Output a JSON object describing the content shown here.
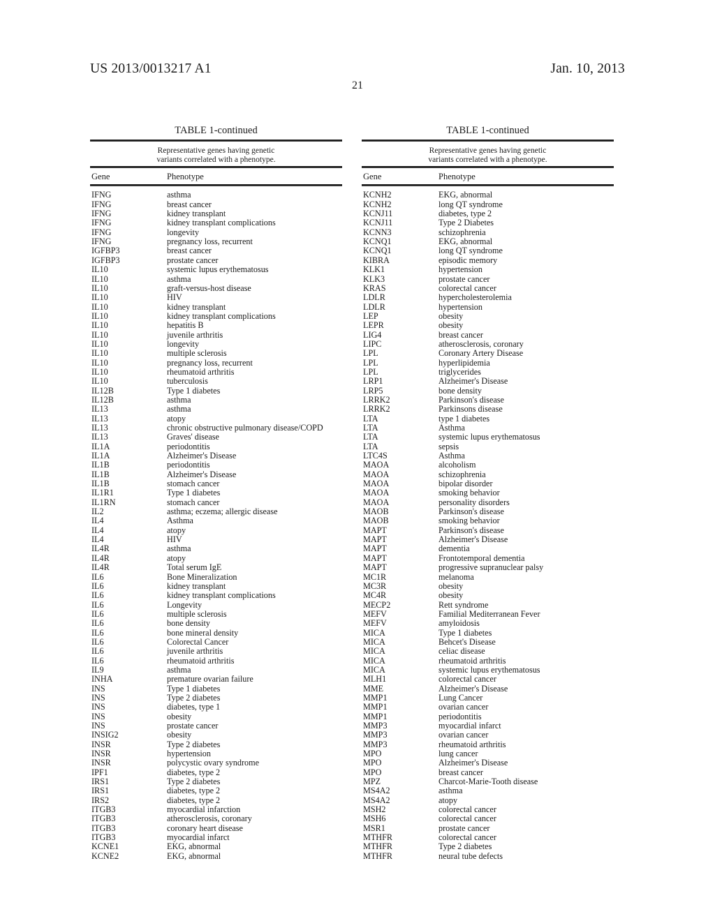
{
  "header": {
    "publication_number": "US 2013/0013217 A1",
    "publication_date": "Jan. 10, 2013",
    "page_number": "21"
  },
  "table": {
    "caption": "TABLE 1-continued",
    "subcaption_line1": "Representative genes having genetic",
    "subcaption_line2": "variants correlated with a phenotype.",
    "column_headers": {
      "gene": "Gene",
      "phenotype": "Phenotype"
    }
  },
  "left_column": {
    "caption": "TABLE 1-continued",
    "subcaption_line1": "Representative genes having genetic",
    "subcaption_line2": "variants correlated with a phenotype.",
    "headers": {
      "gene": "Gene",
      "phenotype": "Phenotype"
    },
    "rows": [
      {
        "gene": "IFNG",
        "phenotype": "asthma"
      },
      {
        "gene": "IFNG",
        "phenotype": "breast cancer"
      },
      {
        "gene": "IFNG",
        "phenotype": "kidney transplant"
      },
      {
        "gene": "IFNG",
        "phenotype": "kidney transplant complications"
      },
      {
        "gene": "IFNG",
        "phenotype": "longevity"
      },
      {
        "gene": "IFNG",
        "phenotype": "pregnancy loss, recurrent"
      },
      {
        "gene": "IGFBP3",
        "phenotype": "breast cancer"
      },
      {
        "gene": "IGFBP3",
        "phenotype": "prostate cancer"
      },
      {
        "gene": "IL10",
        "phenotype": "systemic lupus erythematosus"
      },
      {
        "gene": "IL10",
        "phenotype": "asthma"
      },
      {
        "gene": "IL10",
        "phenotype": "graft-versus-host disease"
      },
      {
        "gene": "IL10",
        "phenotype": "HIV"
      },
      {
        "gene": "IL10",
        "phenotype": "kidney transplant"
      },
      {
        "gene": "IL10",
        "phenotype": "kidney transplant complications"
      },
      {
        "gene": "IL10",
        "phenotype": "hepatitis B"
      },
      {
        "gene": "IL10",
        "phenotype": "juvenile arthritis"
      },
      {
        "gene": "IL10",
        "phenotype": "longevity"
      },
      {
        "gene": "IL10",
        "phenotype": "multiple sclerosis"
      },
      {
        "gene": "IL10",
        "phenotype": "pregnancy loss, recurrent"
      },
      {
        "gene": "IL10",
        "phenotype": "rheumatoid arthritis"
      },
      {
        "gene": "IL10",
        "phenotype": "tuberculosis"
      },
      {
        "gene": "IL12B",
        "phenotype": "Type 1 diabetes"
      },
      {
        "gene": "IL12B",
        "phenotype": "asthma"
      },
      {
        "gene": "IL13",
        "phenotype": "asthma"
      },
      {
        "gene": "IL13",
        "phenotype": "atopy"
      },
      {
        "gene": "IL13",
        "phenotype": "chronic obstructive pulmonary disease/COPD"
      },
      {
        "gene": "IL13",
        "phenotype": "Graves' disease"
      },
      {
        "gene": "IL1A",
        "phenotype": "periodontitis"
      },
      {
        "gene": "IL1A",
        "phenotype": "Alzheimer's Disease"
      },
      {
        "gene": "IL1B",
        "phenotype": "periodontitis"
      },
      {
        "gene": "IL1B",
        "phenotype": "Alzheimer's Disease"
      },
      {
        "gene": "IL1B",
        "phenotype": "stomach cancer"
      },
      {
        "gene": "IL1R1",
        "phenotype": "Type 1 diabetes"
      },
      {
        "gene": "IL1RN",
        "phenotype": "stomach cancer"
      },
      {
        "gene": "IL2",
        "phenotype": "asthma; eczema; allergic disease"
      },
      {
        "gene": "IL4",
        "phenotype": "Asthma"
      },
      {
        "gene": "IL4",
        "phenotype": "atopy"
      },
      {
        "gene": "IL4",
        "phenotype": "HIV"
      },
      {
        "gene": "IL4R",
        "phenotype": "asthma"
      },
      {
        "gene": "IL4R",
        "phenotype": "atopy"
      },
      {
        "gene": "IL4R",
        "phenotype": "Total serum IgE"
      },
      {
        "gene": "IL6",
        "phenotype": "Bone Mineralization"
      },
      {
        "gene": "IL6",
        "phenotype": "kidney transplant"
      },
      {
        "gene": "IL6",
        "phenotype": "kidney transplant complications"
      },
      {
        "gene": "IL6",
        "phenotype": "Longevity"
      },
      {
        "gene": "IL6",
        "phenotype": "multiple sclerosis"
      },
      {
        "gene": "IL6",
        "phenotype": "bone density"
      },
      {
        "gene": "IL6",
        "phenotype": "bone mineral density"
      },
      {
        "gene": "IL6",
        "phenotype": "Colorectal Cancer"
      },
      {
        "gene": "IL6",
        "phenotype": "juvenile arthritis"
      },
      {
        "gene": "IL6",
        "phenotype": "rheumatoid arthritis"
      },
      {
        "gene": "IL9",
        "phenotype": "asthma"
      },
      {
        "gene": "INHA",
        "phenotype": "premature ovarian failure"
      },
      {
        "gene": "INS",
        "phenotype": "Type 1 diabetes"
      },
      {
        "gene": "INS",
        "phenotype": "Type 2 diabetes"
      },
      {
        "gene": "INS",
        "phenotype": "diabetes, type 1"
      },
      {
        "gene": "INS",
        "phenotype": "obesity"
      },
      {
        "gene": "INS",
        "phenotype": "prostate cancer"
      },
      {
        "gene": "INSIG2",
        "phenotype": "obesity"
      },
      {
        "gene": "INSR",
        "phenotype": "Type 2 diabetes"
      },
      {
        "gene": "INSR",
        "phenotype": "hypertension"
      },
      {
        "gene": "INSR",
        "phenotype": "polycystic ovary syndrome"
      },
      {
        "gene": "IPF1",
        "phenotype": "diabetes, type 2"
      },
      {
        "gene": "IRS1",
        "phenotype": "Type 2 diabetes"
      },
      {
        "gene": "IRS1",
        "phenotype": "diabetes, type 2"
      },
      {
        "gene": "IRS2",
        "phenotype": "diabetes, type 2"
      },
      {
        "gene": "ITGB3",
        "phenotype": "myocardial infarction"
      },
      {
        "gene": "ITGB3",
        "phenotype": "atherosclerosis, coronary"
      },
      {
        "gene": "ITGB3",
        "phenotype": "coronary heart disease"
      },
      {
        "gene": "ITGB3",
        "phenotype": "myocardial infarct"
      },
      {
        "gene": "KCNE1",
        "phenotype": "EKG, abnormal"
      },
      {
        "gene": "KCNE2",
        "phenotype": "EKG, abnormal"
      }
    ]
  },
  "right_column": {
    "caption": "TABLE 1-continued",
    "subcaption_line1": "Representative genes having genetic",
    "subcaption_line2": "variants correlated with a phenotype.",
    "headers": {
      "gene": "Gene",
      "phenotype": "Phenotype"
    },
    "rows": [
      {
        "gene": "KCNH2",
        "phenotype": "EKG, abnormal"
      },
      {
        "gene": "KCNH2",
        "phenotype": "long QT syndrome"
      },
      {
        "gene": "KCNJ11",
        "phenotype": "diabetes, type 2"
      },
      {
        "gene": "KCNJ11",
        "phenotype": "Type 2 Diabetes"
      },
      {
        "gene": "KCNN3",
        "phenotype": "schizophrenia"
      },
      {
        "gene": "KCNQ1",
        "phenotype": "EKG, abnormal"
      },
      {
        "gene": "KCNQ1",
        "phenotype": "long QT syndrome"
      },
      {
        "gene": "KIBRA",
        "phenotype": "episodic memory"
      },
      {
        "gene": "KLK1",
        "phenotype": "hypertension"
      },
      {
        "gene": "KLK3",
        "phenotype": "prostate cancer"
      },
      {
        "gene": "KRAS",
        "phenotype": "colorectal cancer"
      },
      {
        "gene": "LDLR",
        "phenotype": "hypercholesterolemia"
      },
      {
        "gene": "LDLR",
        "phenotype": "hypertension"
      },
      {
        "gene": "LEP",
        "phenotype": "obesity"
      },
      {
        "gene": "LEPR",
        "phenotype": "obesity"
      },
      {
        "gene": "LIG4",
        "phenotype": "breast cancer"
      },
      {
        "gene": "LIPC",
        "phenotype": "atherosclerosis, coronary"
      },
      {
        "gene": "LPL",
        "phenotype": "Coronary Artery Disease"
      },
      {
        "gene": "LPL",
        "phenotype": "hyperlipidemia"
      },
      {
        "gene": "LPL",
        "phenotype": "triglycerides"
      },
      {
        "gene": "LRP1",
        "phenotype": "Alzheimer's Disease"
      },
      {
        "gene": "LRP5",
        "phenotype": "bone density"
      },
      {
        "gene": "LRRK2",
        "phenotype": "Parkinson's disease"
      },
      {
        "gene": "LRRK2",
        "phenotype": "Parkinsons disease"
      },
      {
        "gene": "LTA",
        "phenotype": "type 1 diabetes"
      },
      {
        "gene": "LTA",
        "phenotype": "Asthma"
      },
      {
        "gene": "LTA",
        "phenotype": "systemic lupus erythematosus"
      },
      {
        "gene": "LTA",
        "phenotype": "sepsis"
      },
      {
        "gene": "LTC4S",
        "phenotype": "Asthma"
      },
      {
        "gene": "MAOA",
        "phenotype": "alcoholism"
      },
      {
        "gene": "MAOA",
        "phenotype": "schizophrenia"
      },
      {
        "gene": "MAOA",
        "phenotype": "bipolar disorder"
      },
      {
        "gene": "MAOA",
        "phenotype": "smoking behavior"
      },
      {
        "gene": "MAOA",
        "phenotype": "personality disorders"
      },
      {
        "gene": "MAOB",
        "phenotype": "Parkinson's disease"
      },
      {
        "gene": "MAOB",
        "phenotype": "smoking behavior"
      },
      {
        "gene": "MAPT",
        "phenotype": "Parkinson's disease"
      },
      {
        "gene": "MAPT",
        "phenotype": "Alzheimer's Disease"
      },
      {
        "gene": "MAPT",
        "phenotype": "dementia"
      },
      {
        "gene": "MAPT",
        "phenotype": "Frontotemporal dementia"
      },
      {
        "gene": "MAPT",
        "phenotype": "progressive supranuclear palsy"
      },
      {
        "gene": "MC1R",
        "phenotype": "melanoma"
      },
      {
        "gene": "MC3R",
        "phenotype": "obesity"
      },
      {
        "gene": "MC4R",
        "phenotype": "obesity"
      },
      {
        "gene": "MECP2",
        "phenotype": "Rett syndrome"
      },
      {
        "gene": "MEFV",
        "phenotype": "Familial Mediterranean Fever"
      },
      {
        "gene": "MEFV",
        "phenotype": "amyloidosis"
      },
      {
        "gene": "MICA",
        "phenotype": "Type 1 diabetes"
      },
      {
        "gene": "MICA",
        "phenotype": "Behcet's Disease"
      },
      {
        "gene": "MICA",
        "phenotype": "celiac disease"
      },
      {
        "gene": "MICA",
        "phenotype": "rheumatoid arthritis"
      },
      {
        "gene": "MICA",
        "phenotype": "systemic lupus erythematosus"
      },
      {
        "gene": "MLH1",
        "phenotype": "colorectal cancer"
      },
      {
        "gene": "MME",
        "phenotype": "Alzheimer's Disease"
      },
      {
        "gene": "MMP1",
        "phenotype": "Lung Cancer"
      },
      {
        "gene": "MMP1",
        "phenotype": "ovarian cancer"
      },
      {
        "gene": "MMP1",
        "phenotype": "periodontitis"
      },
      {
        "gene": "MMP3",
        "phenotype": "myocardial infarct"
      },
      {
        "gene": "MMP3",
        "phenotype": "ovarian cancer"
      },
      {
        "gene": "MMP3",
        "phenotype": "rheumatoid arthritis"
      },
      {
        "gene": "MPO",
        "phenotype": "lung cancer"
      },
      {
        "gene": "MPO",
        "phenotype": "Alzheimer's Disease"
      },
      {
        "gene": "MPO",
        "phenotype": "breast cancer"
      },
      {
        "gene": "MPZ",
        "phenotype": "Charcot-Marie-Tooth disease"
      },
      {
        "gene": "MS4A2",
        "phenotype": "asthma"
      },
      {
        "gene": "MS4A2",
        "phenotype": "atopy"
      },
      {
        "gene": "MSH2",
        "phenotype": "colorectal cancer"
      },
      {
        "gene": "MSH6",
        "phenotype": "colorectal cancer"
      },
      {
        "gene": "MSR1",
        "phenotype": "prostate cancer"
      },
      {
        "gene": "MTHFR",
        "phenotype": "colorectal cancer"
      },
      {
        "gene": "MTHFR",
        "phenotype": "Type 2 diabetes"
      },
      {
        "gene": "MTHFR",
        "phenotype": "neural tube defects"
      }
    ]
  }
}
